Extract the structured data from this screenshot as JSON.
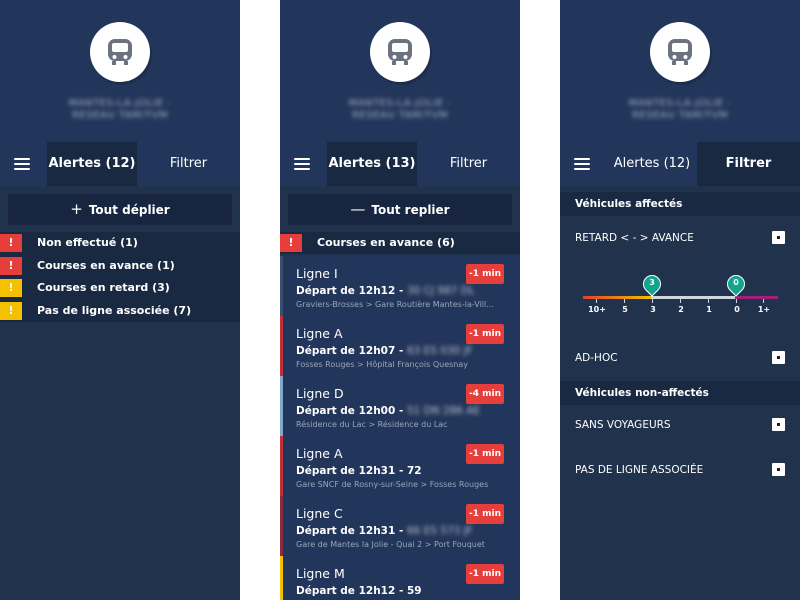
{
  "colors": {
    "panel_bg": "#21324d",
    "header_bg": "#22365b",
    "accent_red": "#e63e3a",
    "accent_yellow": "#f5c000",
    "accent_teal": "#12a58e"
  },
  "header": {
    "network_line1": "MANTES-LA-JOLIE -",
    "network_line2": "RESEAU TAM/TVM"
  },
  "menu_icon": "hamburger-icon",
  "panel1": {
    "tab_alerts": "Alertes (12)",
    "tab_filter": "Filtrer",
    "expand_symbol": "+",
    "expand_label": "Tout déplier",
    "alerts": [
      {
        "label": "Non effectué (1)",
        "level": "red",
        "mark": "!"
      },
      {
        "label": "Courses en avance (1)",
        "level": "red",
        "mark": "!"
      },
      {
        "label": "Courses en retard (3)",
        "level": "yellow",
        "mark": "!"
      },
      {
        "label": "Pas de ligne associée (7)",
        "level": "yellow",
        "mark": "!"
      }
    ]
  },
  "panel2": {
    "tab_alerts": "Alertes (13)",
    "tab_filter": "Filtrer",
    "collapse_symbol": "—",
    "collapse_label": "Tout replier",
    "group_mark": "!",
    "group_label": "Courses en avance (6)",
    "courses": [
      {
        "line": "Ligne I",
        "badge": "-1 min",
        "departure": "Départ de 12h12 -",
        "vehicle": "30 CJ 987 DL",
        "route": "Graviers-Brosses > Gare Routière Mantes-la-Vill...",
        "bar_color": "#3a4f6e"
      },
      {
        "line": "Ligne A",
        "badge": "-1 min",
        "departure": "Départ de 12h07 -",
        "vehicle": "63 ES 030 JF",
        "route": "Fosses Rouges > Hôpital François Quesnay",
        "bar_color": "#c32e3b"
      },
      {
        "line": "Ligne D",
        "badge": "-4 min",
        "departure": "Départ de 12h00 -",
        "vehicle": "51 DN 286 AE",
        "route": "Résidence du Lac > Résidence du Lac",
        "bar_color": "#7fa8c9"
      },
      {
        "line": "Ligne A",
        "badge": "-1 min",
        "departure": "Départ de 12h31 -",
        "vehicle": "72",
        "vehicle_visible": true,
        "route": "Gare SNCF de Rosny-sur-Seine > Fosses Rouges",
        "bar_color": "#c32e3b"
      },
      {
        "line": "Ligne C",
        "badge": "-1 min",
        "departure": "Départ de 12h31 -",
        "vehicle": "66 ES 573 JF",
        "route": "Gare de Mantes la Jolie - Quai 2 > Port Fouquet",
        "bar_color": "#8e2a3d"
      },
      {
        "line": "Ligne M",
        "badge": "-1 min",
        "departure": "Départ de 12h12 -",
        "vehicle": "59",
        "vehicle_visible": true,
        "route": "",
        "bar_color": "#f5c000"
      }
    ]
  },
  "panel3": {
    "tab_alerts": "Alertes (12)",
    "tab_filter": "Filtrer",
    "section_affected": "Véhicules affectés",
    "retard_avance": "RETARD < - > AVANCE",
    "adhoc": "AD-HOC",
    "section_unaffected": "Véhicules non-affectés",
    "sans_voyageurs": "SANS VOYAGEURS",
    "pas_de_ligne": "PAS DE LIGNE ASSOCIÉE",
    "slider": {
      "ticks": [
        "10+",
        "5",
        "3",
        "2",
        "1",
        "0",
        "1+"
      ],
      "handle_low": "3",
      "handle_high": "0"
    }
  }
}
